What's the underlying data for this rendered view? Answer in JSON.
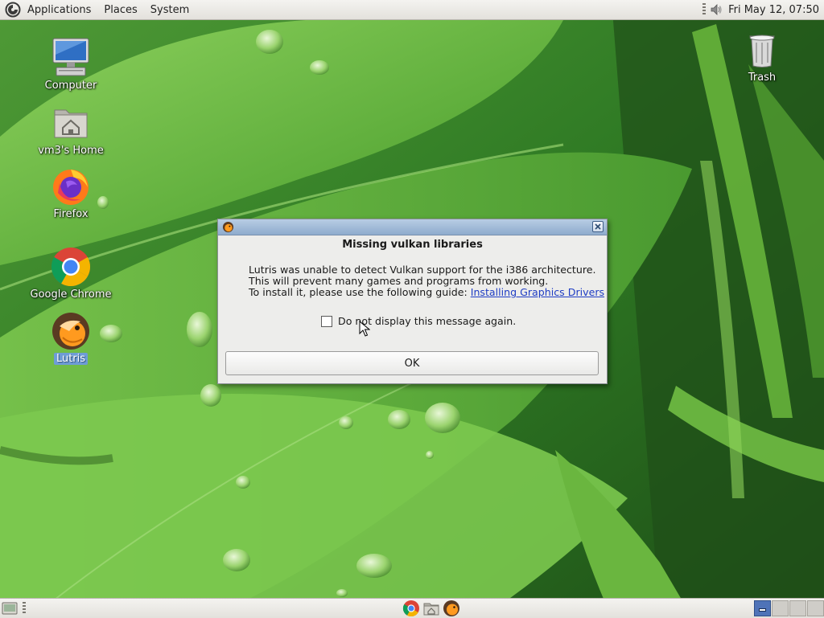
{
  "top_panel": {
    "menus": [
      "Applications",
      "Places",
      "System"
    ],
    "clock": "Fri May 12, 07:50"
  },
  "desktop": {
    "icons": [
      {
        "label": "Computer",
        "icon": "computer-icon"
      },
      {
        "label": "vm3's Home",
        "icon": "home-folder-icon"
      },
      {
        "label": "Firefox",
        "icon": "firefox-icon"
      },
      {
        "label": "Google Chrome",
        "icon": "chrome-icon"
      },
      {
        "label": "Lutris",
        "icon": "lutris-icon",
        "selected": true
      },
      {
        "label": "Trash",
        "icon": "trash-icon"
      }
    ]
  },
  "dialog": {
    "heading": "Missing vulkan libraries",
    "line1": "Lutris was unable to detect Vulkan support for the i386 architecture.",
    "line2": "This will prevent many games and programs from working.",
    "line3_prefix": "To install it, please use the following guide: ",
    "link_text": "Installing Graphics Drivers",
    "checkbox_label": "Do not display this message again.",
    "checkbox_checked": false,
    "ok_label": "OK"
  },
  "bottom_panel": {
    "launchers": [
      "chrome-icon",
      "file-manager-icon",
      "lutris-icon"
    ],
    "workspaces": 4,
    "active_workspace": 1
  },
  "colors": {
    "panel_bg": "#e8e6e1",
    "titlebar": "#a9c0dc",
    "link": "#1f3dc4",
    "selection": "#6e9cd6"
  }
}
